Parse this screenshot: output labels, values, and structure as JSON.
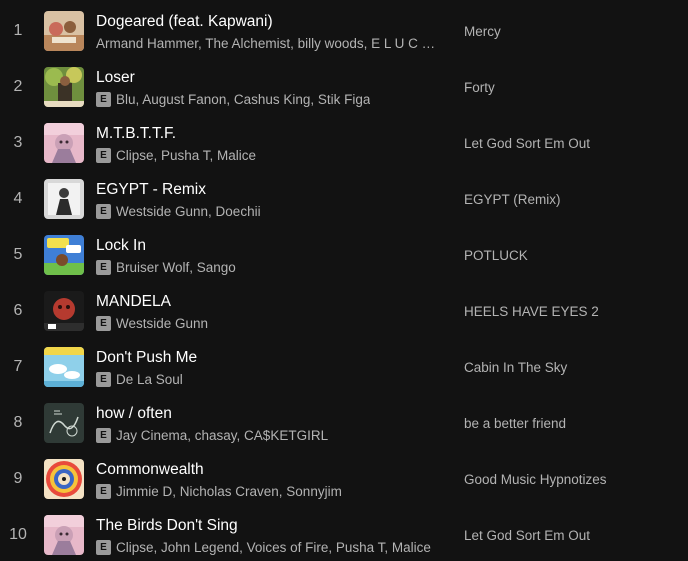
{
  "tracks": [
    {
      "num": "1",
      "title": "Dogeared (feat. Kapwani)",
      "explicit": false,
      "artists": "Armand Hammer, The Alchemist, billy woods, E L U C …",
      "album": "Mercy",
      "art": "art-1"
    },
    {
      "num": "2",
      "title": "Loser",
      "explicit": true,
      "artists": "Blu, August Fanon, Cashus King, Stik Figa",
      "album": "Forty",
      "art": "art-2"
    },
    {
      "num": "3",
      "title": "M.T.B.T.T.F.",
      "explicit": true,
      "artists": "Clipse, Pusha T, Malice",
      "album": "Let God Sort Em Out",
      "art": "art-3"
    },
    {
      "num": "4",
      "title": "EGYPT - Remix",
      "explicit": true,
      "artists": "Westside Gunn, Doechii",
      "album": "EGYPT (Remix)",
      "art": "art-4"
    },
    {
      "num": "5",
      "title": "Lock In",
      "explicit": true,
      "artists": "Bruiser Wolf, Sango",
      "album": "POTLUCK",
      "art": "art-5"
    },
    {
      "num": "6",
      "title": "MANDELA",
      "explicit": true,
      "artists": "Westside Gunn",
      "album": "HEELS HAVE EYES 2",
      "art": "art-6"
    },
    {
      "num": "7",
      "title": "Don't Push Me",
      "explicit": true,
      "artists": "De La Soul",
      "album": "Cabin In The Sky",
      "art": "art-7"
    },
    {
      "num": "8",
      "title": "how / often",
      "explicit": true,
      "artists": "Jay Cinema, chasay, CA$KETGIRL",
      "album": "be a better friend",
      "art": "art-8"
    },
    {
      "num": "9",
      "title": "Commonwealth",
      "explicit": true,
      "artists": "Jimmie D, Nicholas Craven, Sonnyjim",
      "album": "Good Music Hypnotizes",
      "art": "art-9"
    },
    {
      "num": "10",
      "title": "The Birds Don't Sing",
      "explicit": true,
      "artists": "Clipse, John Legend, Voices of Fire, Pusha T, Malice",
      "album": "Let God Sort Em Out",
      "art": "art-3"
    }
  ],
  "explicit_badge": "E"
}
